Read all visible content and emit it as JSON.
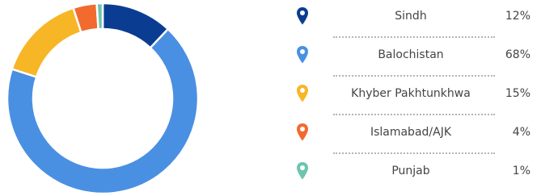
{
  "chart_data": {
    "type": "pie",
    "variant": "donut",
    "legend_position": "right",
    "slices": [
      {
        "label": "Sindh",
        "value": 12,
        "value_label": "12%",
        "color": "#0a3d91",
        "icon": "map-pin-icon"
      },
      {
        "label": "Balochistan",
        "value": 68,
        "value_label": "68%",
        "color": "#4a90e2",
        "icon": "map-pin-icon"
      },
      {
        "label": "Khyber Pakhtunkhwa",
        "value": 15,
        "value_label": "15%",
        "color": "#f7b626",
        "icon": "map-pin-icon"
      },
      {
        "label": "Islamabad/AJK",
        "value": 4,
        "value_label": "4%",
        "color": "#f26a2e",
        "icon": "map-pin-icon"
      },
      {
        "label": "Punjab",
        "value": 1,
        "value_label": "1%",
        "color": "#6cc5b0",
        "icon": "map-pin-icon"
      }
    ]
  }
}
